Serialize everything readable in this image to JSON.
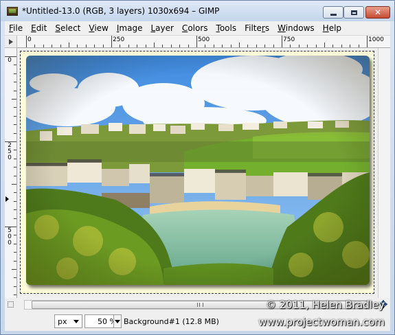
{
  "window": {
    "title": "*Untitled-13.0 (RGB, 3 layers) 1030x694 – GIMP"
  },
  "menu": [
    {
      "label": "File",
      "accel": "F",
      "rest": "ile"
    },
    {
      "label": "Edit",
      "accel": "E",
      "rest": "dit"
    },
    {
      "label": "Select",
      "accel": "S",
      "rest": "elect"
    },
    {
      "label": "View",
      "accel": "V",
      "rest": "iew"
    },
    {
      "label": "Image",
      "accel": "I",
      "rest": "mage"
    },
    {
      "label": "Layer",
      "accel": "L",
      "rest": "ayer"
    },
    {
      "label": "Colors",
      "accel": "C",
      "rest": "olors"
    },
    {
      "label": "Tools",
      "accel": "T",
      "rest": "ools"
    },
    {
      "label": "Filters",
      "accel": "r",
      "pre": "Filte",
      "post": "s"
    },
    {
      "label": "Windows",
      "accel": "W",
      "rest": "indows"
    },
    {
      "label": "Help",
      "accel": "H",
      "rest": "elp"
    }
  ],
  "rulers": {
    "horizontal_labels": [
      "0",
      "250",
      "500",
      "750",
      "1000"
    ],
    "vertical_labels": [
      "0",
      "250",
      "500"
    ]
  },
  "status": {
    "unit": "px",
    "zoom": "50 %",
    "info": "Background#1 (12.8 MB)"
  },
  "watermark": {
    "line1": "© 2011, Helen Bradley",
    "line2": "www.projectwoman.com"
  },
  "colors": {
    "sky": "#5f9fe4",
    "grass": "#6e9f2a",
    "sea": "#8fc2a8",
    "layer_bg": "#fdfcd9"
  }
}
